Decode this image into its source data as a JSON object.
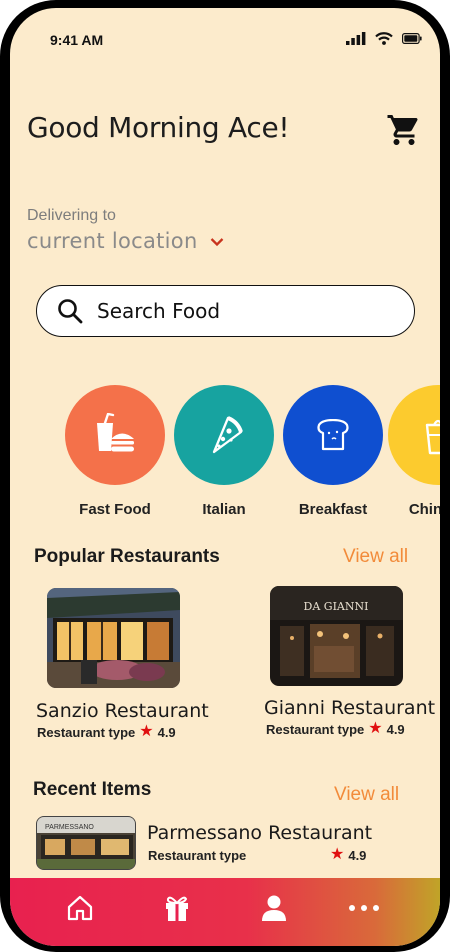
{
  "status": {
    "time": "9:41 AM"
  },
  "header": {
    "greeting": "Good Morning Ace!"
  },
  "delivery": {
    "label": "Delivering to",
    "location": "current location"
  },
  "search": {
    "placeholder": "Search Food"
  },
  "categories": [
    {
      "label": "Fast Food",
      "color": "#f4714a",
      "icon": "fast-food-icon"
    },
    {
      "label": "Italian",
      "color": "#17a3a0",
      "icon": "pizza-icon"
    },
    {
      "label": "Breakfast",
      "color": "#0f4fd0",
      "icon": "bread-icon"
    },
    {
      "label": "Chinese",
      "color": "#fccb2e",
      "icon": "chinese-food-icon"
    }
  ],
  "popular": {
    "title": "Popular Restaurants",
    "view_all": "View all",
    "items": [
      {
        "name": "Sanzio Restaurant",
        "type": "Restaurant type",
        "rating": "4.9"
      },
      {
        "name": "Gianni Restaurant",
        "type": "Restaurant type",
        "rating": "4.9",
        "sign": "DA GIANNI"
      }
    ]
  },
  "recent": {
    "title": "Recent Items",
    "view_all": "View all",
    "items": [
      {
        "name": "Parmessano Restaurant",
        "type": "Restaurant type",
        "rating": "4.9",
        "sign": "PARMESSANO"
      }
    ]
  },
  "colors": {
    "accent": "#f28b3a",
    "background": "#fcebcc",
    "star": "#e01010"
  },
  "nav": [
    "home-icon",
    "gift-icon",
    "profile-icon",
    "more-icon"
  ]
}
